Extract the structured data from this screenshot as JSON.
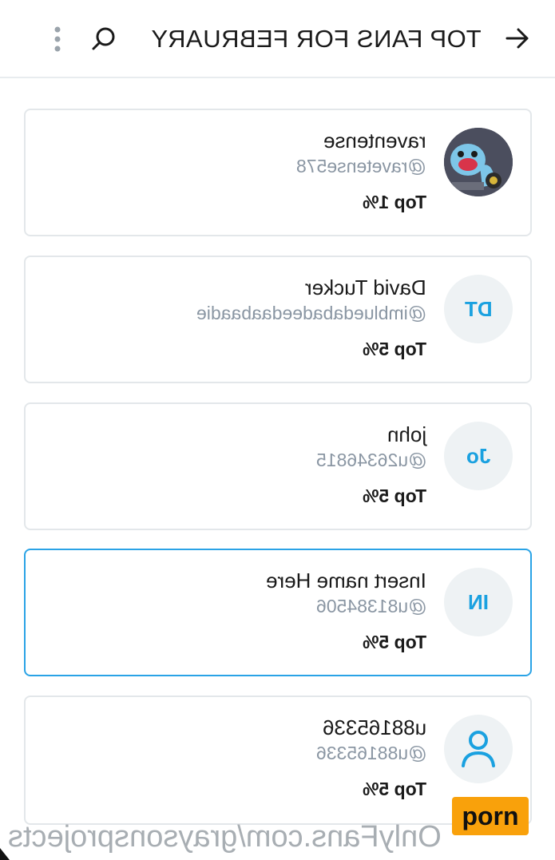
{
  "header": {
    "title": "TOP FANS FOR FEBRUARY",
    "back_icon": "arrow-left-icon",
    "search_icon": "search-icon",
    "more_icon": "more-vertical-icon"
  },
  "fans": [
    {
      "name": "raventense",
      "handle": "@ravetense578",
      "rank": "Top 1%",
      "avatar_type": "image",
      "initials": ""
    },
    {
      "name": "David Tucker",
      "handle": "@imbluedabadeedaabaadie",
      "rank": "Top 5%",
      "avatar_type": "initials",
      "initials": "DT"
    },
    {
      "name": "john",
      "handle": "@u26346815",
      "rank": "Top 5%",
      "avatar_type": "initials",
      "initials": "Jo"
    },
    {
      "name": "Insert name Here",
      "handle": "@u81384506",
      "rank": "Top 5%",
      "avatar_type": "initials",
      "initials": "IN",
      "selected": true
    },
    {
      "name": "u88165336",
      "handle": "@u88165336",
      "rank": "Top 5%",
      "avatar_type": "user-icon",
      "initials": ""
    }
  ],
  "watermark": {
    "text": "OnlyFans.com/graysonsprojects",
    "badge": "porn"
  },
  "colors": {
    "accent": "#1aa1e0",
    "selected_border": "#2aa3e6",
    "muted_text": "#8a96a3",
    "badge_bg": "#f9a10b"
  }
}
